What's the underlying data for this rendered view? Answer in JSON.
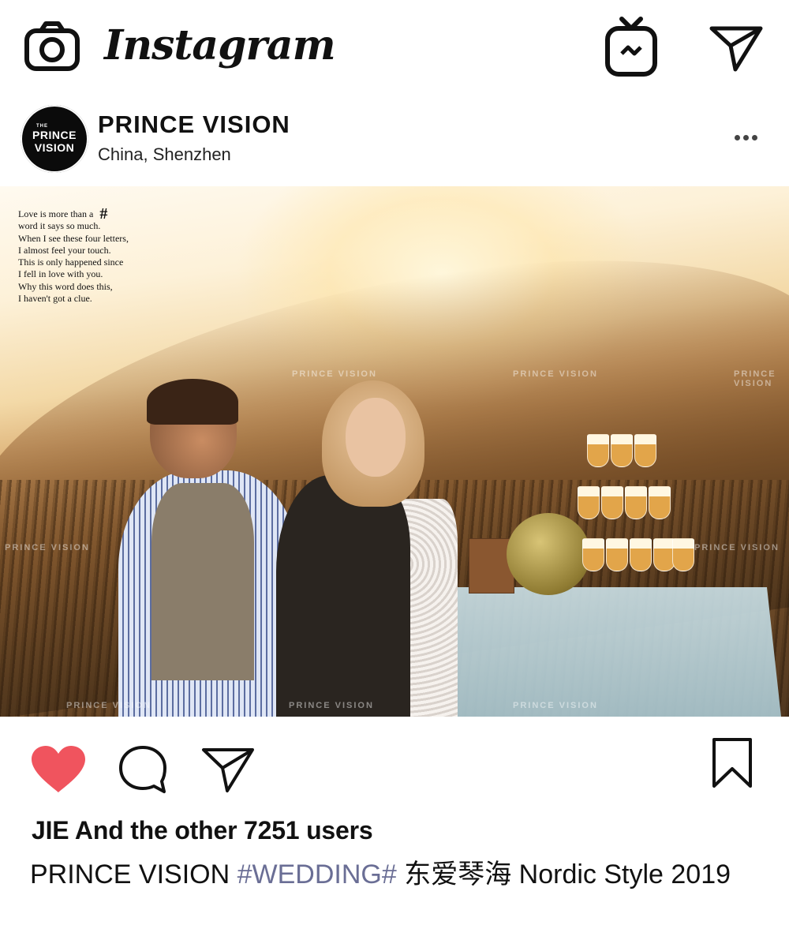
{
  "app": {
    "title": "Instagram"
  },
  "post": {
    "account_name": "PRINCE VISION",
    "location": "China, Shenzhen",
    "avatar": {
      "small_text": "THE",
      "line1": "PRINCE",
      "line2": "VISION"
    },
    "image_text": {
      "lines": [
        "Love is more than a",
        "word it says so much.",
        "When I see these four letters,",
        "I almost feel your touch.",
        "This is only happened since",
        "I fell in love with you.",
        "Why this word does this,",
        "I haven't got a clue."
      ],
      "hash_symbol": "#",
      "watermark": "PRINCE VISION"
    },
    "likes_text": "JIE And the other 7251 users",
    "caption": {
      "account": "PRINCE VISION",
      "hashtag": "#WEDDING#",
      "text": "东爱琴海 Nordic Style 2019"
    },
    "liked": true
  },
  "icons": {
    "camera": "camera-icon",
    "igtv": "igtv-icon",
    "direct": "send-icon",
    "more": "more-options-icon",
    "like": "heart-icon",
    "comment": "comment-icon",
    "share": "share-icon",
    "save": "bookmark-icon"
  },
  "colors": {
    "heart": "#f0545e",
    "hashtag": "#6a6e95",
    "text": "#111111",
    "background": "#ffffff"
  }
}
